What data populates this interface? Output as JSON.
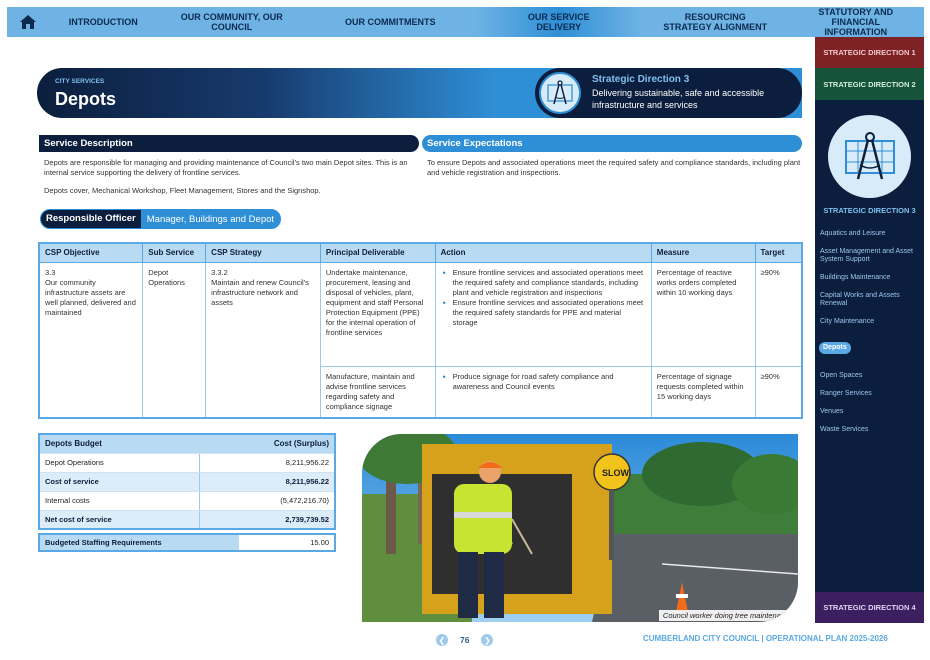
{
  "nav": {
    "items": [
      {
        "label": "INTRODUCTION"
      },
      {
        "label": "OUR COMMUNITY, OUR COUNCIL"
      },
      {
        "label": "OUR COMMITMENTS"
      },
      {
        "label": "OUR SERVICE DELIVERY"
      },
      {
        "label": "RESOURCING STRATEGY ALIGNMENT"
      },
      {
        "label": "STATUTORY AND FINANCIAL INFORMATION"
      }
    ]
  },
  "sidebar": {
    "sd1": "STRATEGIC DIRECTION 1",
    "sd2": "STRATEGIC DIRECTION 2",
    "sd3": "STRATEGIC DIRECTION 3",
    "sd4": "STRATEGIC DIRECTION 4",
    "items": [
      {
        "label": "Aquatics and Leisure"
      },
      {
        "label": "Asset Management and Asset System Support"
      },
      {
        "label": "Buildings Maintenance"
      },
      {
        "label": "Capital Works and Assets Renewal"
      },
      {
        "label": "City Maintenance"
      },
      {
        "label": "Depots"
      },
      {
        "label": "Open Spaces"
      },
      {
        "label": "Ranger Services"
      },
      {
        "label": "Venues"
      },
      {
        "label": "Waste Services"
      }
    ]
  },
  "header": {
    "kicker": "CITY SERVICES",
    "title": "Depots",
    "sd_title": "Strategic Direction 3",
    "sd_desc": "Delivering sustainable, safe and accessible infrastructure and services"
  },
  "service": {
    "desc_title": "Service Description",
    "desc_p1": "Depots are responsible for managing and providing maintenance of Council's two main Depot sites. This is an internal service supporting the delivery of frontline services.",
    "desc_p2": "Depots cover, Mechanical Workshop, Fleet Management, Stores and the Signshop.",
    "exp_title": "Service Expectations",
    "exp_p1": "To ensure Depots and associated operations meet the required safety and compliance standards, including plant and vehicle registration and inspections."
  },
  "officer": {
    "label": "Responsible Officer",
    "value": "Manager, Buildings and Depot"
  },
  "table": {
    "headers": [
      "CSP Objective",
      "Sub Service",
      "CSP Strategy",
      "Principal Deliverable",
      "Action",
      "Measure",
      "Target"
    ],
    "objective": "3.3\nOur community infrastructure assets are well planned, delivered and maintained",
    "objective_num": "3.3",
    "objective_text": "Our community infrastructure assets are well planned, delivered and maintained",
    "sub_service": "Depot Operations",
    "strategy_num": "3.3.2",
    "strategy_text": "Maintain and renew Council's infrastructure network and assets",
    "rows": [
      {
        "deliverable": "Undertake maintenance, procurement, leasing and disposal of vehicles, plant, equipment and staff Personal Protection Equipment (PPE) for the internal operation of frontline services",
        "actions": [
          "Ensure frontline services and associated operations meet the required safety and compliance standards, including plant and vehicle registration and inspections",
          "Ensure frontline services and associated operations meet the required safety standards for PPE and material storage"
        ],
        "measure": "Percentage of reactive works orders completed within 10 working days",
        "target": "≥90%"
      },
      {
        "deliverable": "Manufacture, maintain and advise frontline services regarding safety and compliance signage",
        "actions": [
          "Produce signage for road safety compliance and awareness and Council events"
        ],
        "measure": "Percentage of signage requests completed within 15 working days",
        "target": "≥90%"
      }
    ]
  },
  "budget": {
    "h1": "Depots Budget",
    "h2": "Cost (Surplus)",
    "rows": [
      {
        "label": "Depot Operations",
        "value": "8,211,956.22"
      },
      {
        "label": "Cost of service",
        "value": "8,211,956.22"
      },
      {
        "label": "Internal costs",
        "value": "(5,472,216.70)"
      },
      {
        "label": "Net cost of service",
        "value": "2,739,739.52"
      }
    ],
    "staff_label": "Budgeted Staffing Requirements",
    "staff_value": "15.00"
  },
  "photo": {
    "caption": "Council worker doing tree maintenance",
    "sign_text": "SLOW"
  },
  "footer": {
    "page": "76",
    "text": "CUMBERLAND CITY COUNCIL  |  OPERATIONAL PLAN 2025-2026"
  }
}
